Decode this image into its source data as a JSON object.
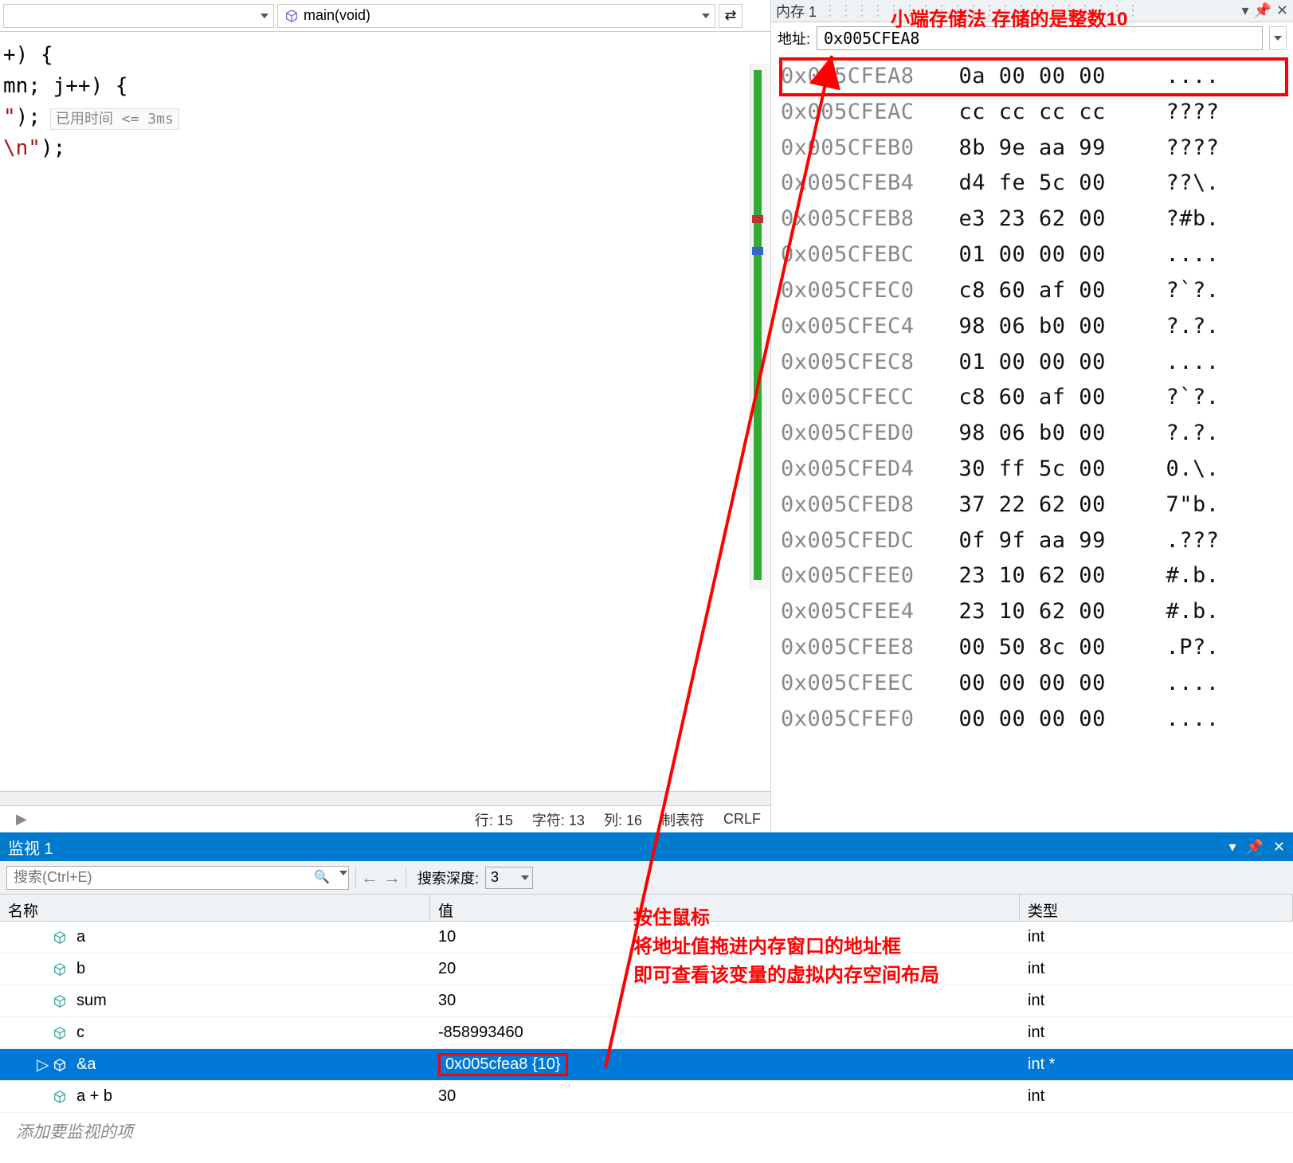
{
  "breadcrumb": {
    "scope": "",
    "function": "main(void)"
  },
  "code": {
    "lines": [
      {
        "text": "+) {"
      },
      {
        "text": "mn; j++) {"
      },
      {
        "text": ""
      },
      {
        "text": ""
      },
      {
        "text": ""
      },
      {
        "text": ""
      },
      {
        "text": ""
      },
      {
        "text": ""
      },
      {
        "text": ""
      },
      {
        "text": ""
      },
      {
        "text": ""
      },
      {
        "hint": "已用时间 <= 3ms",
        "str": "\");"
      },
      {
        "text": ""
      },
      {
        "text": ""
      },
      {
        "text": ""
      },
      {
        "str": "\\n\");"
      },
      {
        "text": ""
      },
      {
        "text": ""
      }
    ]
  },
  "status": {
    "line": "行: 15",
    "char": "字符: 13",
    "col": "列: 16",
    "tabs": "制表符",
    "crlf": "CRLF"
  },
  "memory": {
    "title": "内存 1",
    "addr_label": "地址:",
    "addr_value": "0x005CFEA8",
    "rows": [
      {
        "addr": "0x005CFEA8",
        "bytes": "0a 00 00 00",
        "ascii": "....",
        "hl": true
      },
      {
        "addr": "0x005CFEAC",
        "bytes": "cc cc cc cc",
        "ascii": "????"
      },
      {
        "addr": "0x005CFEB0",
        "bytes": "8b 9e aa 99",
        "ascii": "????"
      },
      {
        "addr": "0x005CFEB4",
        "bytes": "d4 fe 5c 00",
        "ascii": "??\\."
      },
      {
        "addr": "0x005CFEB8",
        "bytes": "e3 23 62 00",
        "ascii": "?#b."
      },
      {
        "addr": "0x005CFEBC",
        "bytes": "01 00 00 00",
        "ascii": "...."
      },
      {
        "addr": "0x005CFEC0",
        "bytes": "c8 60 af 00",
        "ascii": "?`?."
      },
      {
        "addr": "0x005CFEC4",
        "bytes": "98 06 b0 00",
        "ascii": "?.?."
      },
      {
        "addr": "0x005CFEC8",
        "bytes": "01 00 00 00",
        "ascii": "...."
      },
      {
        "addr": "0x005CFECC",
        "bytes": "c8 60 af 00",
        "ascii": "?`?."
      },
      {
        "addr": "0x005CFED0",
        "bytes": "98 06 b0 00",
        "ascii": "?.?."
      },
      {
        "addr": "0x005CFED4",
        "bytes": "30 ff 5c 00",
        "ascii": "0.\\."
      },
      {
        "addr": "0x005CFED8",
        "bytes": "37 22 62 00",
        "ascii": "7\"b."
      },
      {
        "addr": "0x005CFEDC",
        "bytes": "0f 9f aa 99",
        "ascii": ".???"
      },
      {
        "addr": "0x005CFEE0",
        "bytes": "23 10 62 00",
        "ascii": "#.b."
      },
      {
        "addr": "0x005CFEE4",
        "bytes": "23 10 62 00",
        "ascii": "#.b."
      },
      {
        "addr": "0x005CFEE8",
        "bytes": "00 50 8c 00",
        "ascii": ".P?."
      },
      {
        "addr": "0x005CFEEC",
        "bytes": "00 00 00 00",
        "ascii": "...."
      },
      {
        "addr": "0x005CFEF0",
        "bytes": "00 00 00 00",
        "ascii": "...."
      }
    ]
  },
  "annotations": {
    "top": "小端存储法 存储的是整数10",
    "mid_l1": "按住鼠标",
    "mid_l2": "将地址值拖进内存窗口的地址框",
    "mid_l3": "即可查看该变量的虚拟内存空间布局"
  },
  "watch": {
    "title": "监视 1",
    "search_placeholder": "搜索(Ctrl+E)",
    "depth_label": "搜索深度:",
    "depth_value": "3",
    "col_name": "名称",
    "col_value": "值",
    "col_type": "类型",
    "rows": [
      {
        "name": "a",
        "value": "10",
        "type": "int"
      },
      {
        "name": "b",
        "value": "20",
        "type": "int"
      },
      {
        "name": "sum",
        "value": "30",
        "type": "int"
      },
      {
        "name": "c",
        "value": "-858993460",
        "type": "int"
      },
      {
        "name": "&a",
        "value": "0x005cfea8 {10}",
        "type": "int *",
        "selected": true,
        "expandable": true,
        "box": true
      },
      {
        "name": "a + b",
        "value": "30",
        "type": "int"
      }
    ],
    "placeholder": "添加要监视的项"
  }
}
